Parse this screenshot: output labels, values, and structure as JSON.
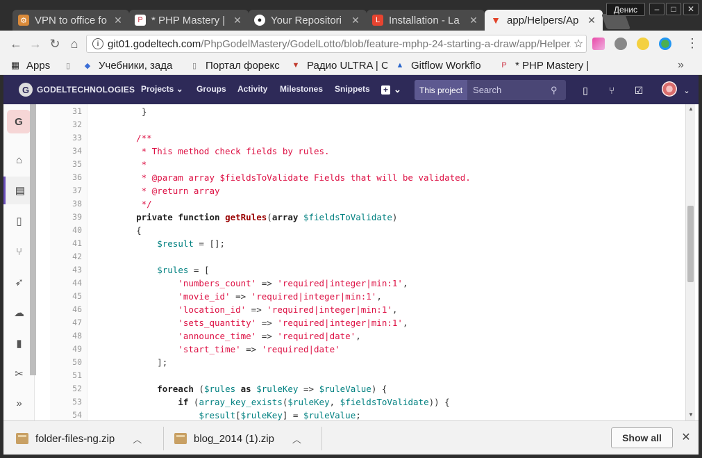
{
  "window": {
    "user_name": "Денис",
    "controls": {
      "minimize": "–",
      "maximize": "□",
      "close": "✕"
    }
  },
  "tabs": [
    {
      "label": "VPN to office fo",
      "icon": "vpn-icon",
      "color": "#d98a3a"
    },
    {
      "label": "* PHP Mastery |",
      "icon": "php-mastery-icon",
      "color": "#cc3344"
    },
    {
      "label": "Your Repositori",
      "icon": "github-icon",
      "color": "#222222"
    },
    {
      "label": "Installation - La",
      "icon": "laravel-icon",
      "color": "#e74430"
    },
    {
      "label": "app/Helpers/Ap",
      "icon": "gitlab-icon",
      "color": "#e24329",
      "active": true
    }
  ],
  "toolbar": {
    "url_host": "git01.godeltech.com",
    "url_path": "/PhpGodelMastery/GodelLotto/blob/feature-mphp-24-starting-a-draw/app/Helper..."
  },
  "bookmarks": [
    {
      "label": "Apps",
      "icon": "apps-grid-icon"
    },
    {
      "label": "",
      "icon": "file-icon"
    },
    {
      "label": "Учебники, зада",
      "icon": "textbook-icon"
    },
    {
      "label": "Портал форекс",
      "icon": "file-icon"
    },
    {
      "label": "Радио ULTRA | С",
      "icon": "tshirt-icon"
    },
    {
      "label": "Gitflow Workflo",
      "icon": "atlassian-icon"
    },
    {
      "label": "* PHP Mastery |",
      "icon": "php-mastery-icon"
    }
  ],
  "gitlab": {
    "brand": "GODELTECHNOLOGIES",
    "nav": [
      "Projects",
      "Groups",
      "Activity",
      "Milestones",
      "Snippets"
    ],
    "search_scope": "This project",
    "search_placeholder": "Search",
    "group_initial": "G",
    "accent_color": "#2e2a58"
  },
  "code_lines": [
    {
      "n": "31",
      "html": "<span style=\"padding-left:38px\"></span>}"
    },
    {
      "n": "32",
      "html": ""
    },
    {
      "n": "33",
      "html": "<span class=\"c\">    /**</span>"
    },
    {
      "n": "34",
      "html": "<span class=\"c\">     * This method check fields by rules.</span>"
    },
    {
      "n": "35",
      "html": "<span class=\"c\">     *</span>"
    },
    {
      "n": "36",
      "html": "<span class=\"c\">     * @param array $fieldsToValidate Fields that will be validated.</span>"
    },
    {
      "n": "37",
      "html": "<span class=\"c\">     * @return array</span>"
    },
    {
      "n": "38",
      "html": "<span class=\"c\">     */</span>"
    },
    {
      "n": "39",
      "html": "    <span class=\"k\">private function</span> <span class=\"fn\">getRules</span>(<span class=\"k\">array</span> <span class=\"v\">$fieldsToValidate</span>)"
    },
    {
      "n": "40",
      "html": "    {"
    },
    {
      "n": "41",
      "html": "        <span class=\"v\">$result</span> = [];"
    },
    {
      "n": "42",
      "html": ""
    },
    {
      "n": "43",
      "html": "        <span class=\"v\">$rules</span> = ["
    },
    {
      "n": "44",
      "html": "            <span class=\"s\">'numbers_count'</span> => <span class=\"s\">'required|integer|min:1'</span>,"
    },
    {
      "n": "45",
      "html": "            <span class=\"s\">'movie_id'</span> => <span class=\"s\">'required|integer|min:1'</span>,"
    },
    {
      "n": "46",
      "html": "            <span class=\"s\">'location_id'</span> => <span class=\"s\">'required|integer|min:1'</span>,"
    },
    {
      "n": "47",
      "html": "            <span class=\"s\">'sets_quantity'</span> => <span class=\"s\">'required|integer|min:1'</span>,"
    },
    {
      "n": "48",
      "html": "            <span class=\"s\">'announce_time'</span> => <span class=\"s\">'required|date'</span>,"
    },
    {
      "n": "49",
      "html": "            <span class=\"s\">'start_time'</span> => <span class=\"s\">'required|date'</span>"
    },
    {
      "n": "50",
      "html": "        ];"
    },
    {
      "n": "51",
      "html": ""
    },
    {
      "n": "52",
      "html": "        <span class=\"k\">foreach</span> (<span class=\"v\">$rules</span> <span class=\"k\">as</span> <span class=\"v\">$ruleKey</span> => <span class=\"v\">$ruleValue</span>) {"
    },
    {
      "n": "53",
      "html": "            <span class=\"k\">if</span> (<span class=\"v\">array_key_exists</span>(<span class=\"v\">$ruleKey</span>, <span class=\"v\">$fieldsToValidate</span>)) {"
    },
    {
      "n": "54",
      "html": "                <span class=\"v\">$result</span>[<span class=\"v\">$ruleKey</span>] = <span class=\"v\">$ruleValue</span>;"
    }
  ],
  "downloads": [
    {
      "name": "folder-files-ng.zip"
    },
    {
      "name": "blog_2014 (1).zip"
    }
  ],
  "downloads_bar": {
    "show_all": "Show all",
    "close": "✕"
  }
}
